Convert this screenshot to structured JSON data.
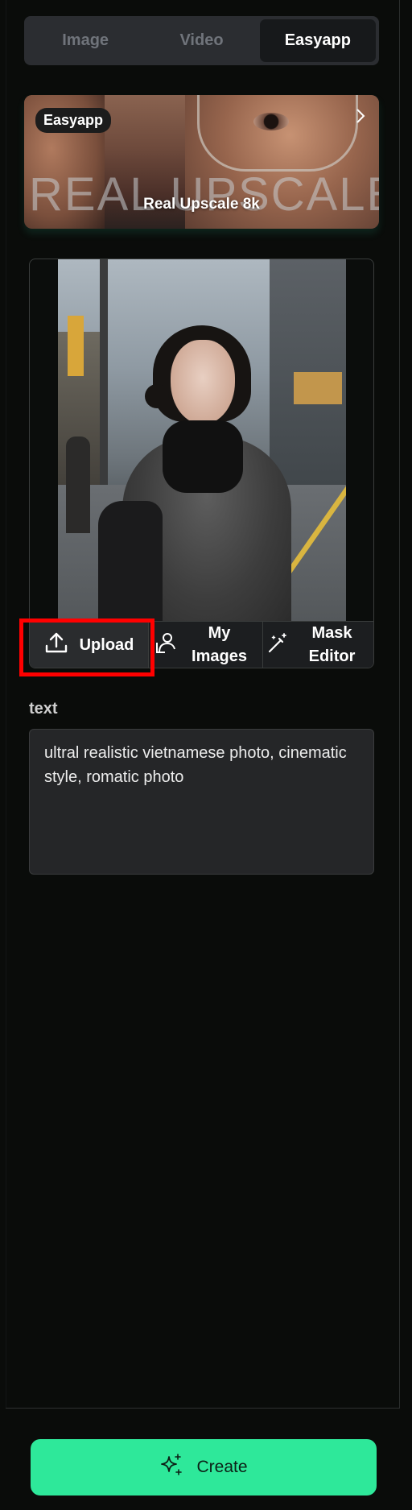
{
  "tabs": [
    {
      "label": "Image",
      "active": false
    },
    {
      "label": "Video",
      "active": false
    },
    {
      "label": "Easyapp",
      "active": true
    }
  ],
  "banner": {
    "pill": "Easyapp",
    "background_text": "REAL UPSCALE",
    "title": "Real Upscale 8k"
  },
  "image_actions": {
    "upload": "Upload",
    "my_images_line1": "My",
    "my_images_line2": "Images",
    "mask_line1": "Mask",
    "mask_line2": "Editor"
  },
  "text_field": {
    "label": "text",
    "value": "ultral realistic vietnamese photo, cinematic style, romatic photo"
  },
  "create_button": {
    "label": "Create"
  },
  "colors": {
    "accent": "#2ee89a",
    "highlight": "#ff0000",
    "background": "#0a0c0a"
  }
}
